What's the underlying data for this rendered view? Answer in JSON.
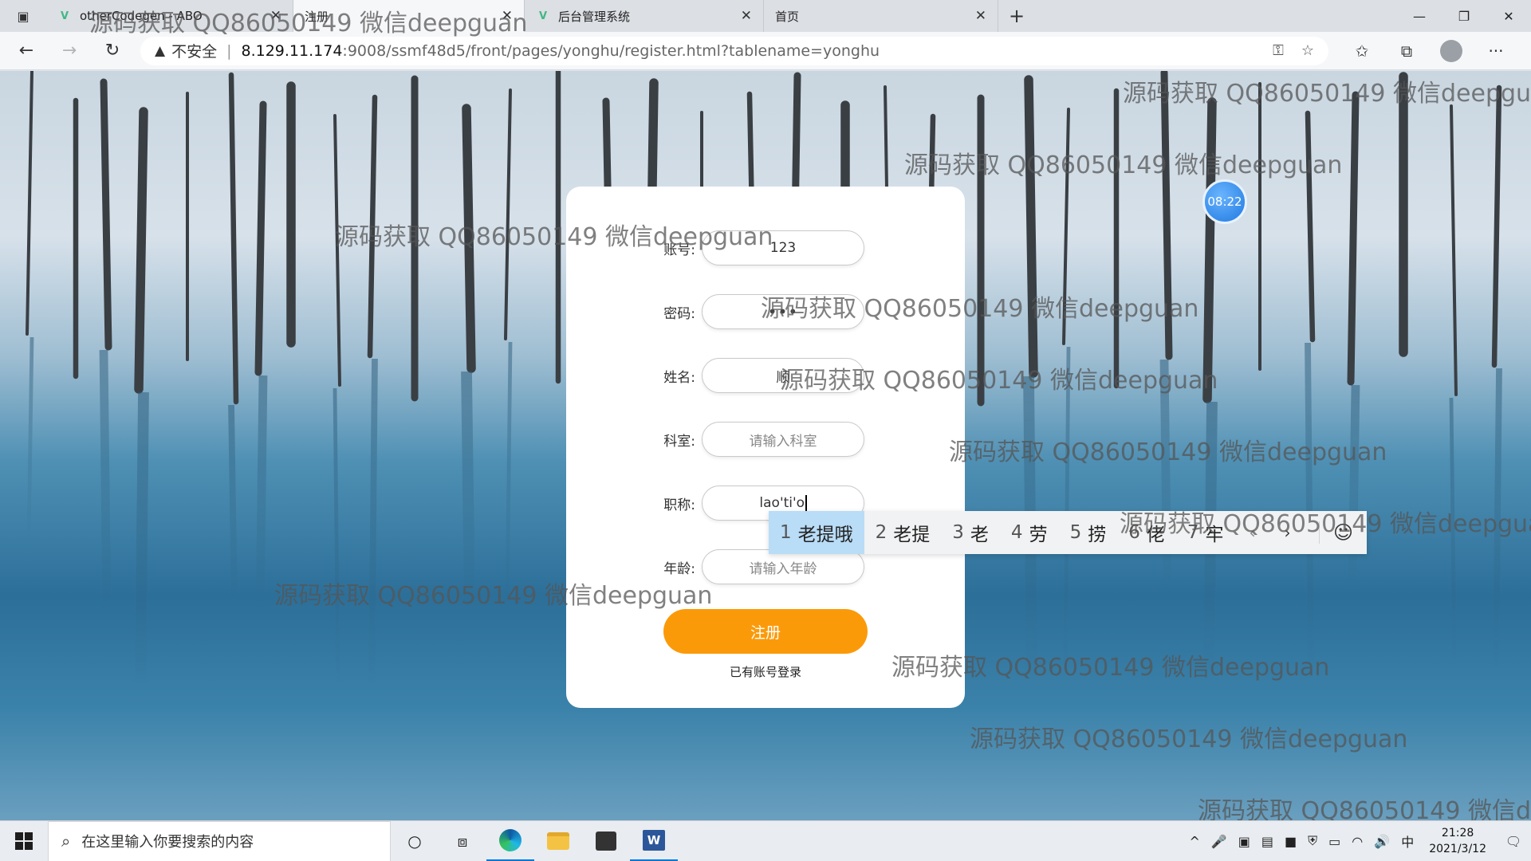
{
  "browser": {
    "tabs": [
      {
        "title": "otherCodegen - ABO",
        "icon": "vue-icon",
        "active": false
      },
      {
        "title": "注册",
        "icon": "page-icon",
        "active": true
      },
      {
        "title": "后台管理系统",
        "icon": "vue-icon",
        "active": false
      },
      {
        "title": "首页",
        "icon": "page-icon",
        "active": false
      }
    ],
    "address": {
      "security_label": "不安全",
      "host": "8.129.11.174",
      "rest": ":9008/ssmf48d5/front/pages/yonghu/register.html?tablename=yonghu"
    }
  },
  "overlay": {
    "bubble_time": "08:22"
  },
  "form": {
    "fields": [
      {
        "label": "账号:",
        "value": "123",
        "placeholder": "",
        "type": "text"
      },
      {
        "label": "密码:",
        "value": "•••",
        "placeholder": "",
        "type": "password"
      },
      {
        "label": "姓名:",
        "value": "顺",
        "placeholder": "",
        "type": "text"
      },
      {
        "label": "科室:",
        "value": "",
        "placeholder": "请输入科室",
        "type": "text"
      },
      {
        "label": "职称:",
        "value": "lao'ti'o",
        "placeholder": "",
        "type": "text"
      },
      {
        "label": "年龄:",
        "value": "",
        "placeholder": "请输入年龄",
        "type": "text"
      }
    ],
    "submit_label": "注册",
    "login_link": "已有账号登录"
  },
  "ime": {
    "candidates": [
      {
        "n": "1",
        "text": "老提哦"
      },
      {
        "n": "2",
        "text": "老提"
      },
      {
        "n": "3",
        "text": "老"
      },
      {
        "n": "4",
        "text": "劳"
      },
      {
        "n": "5",
        "text": "捞"
      },
      {
        "n": "6",
        "text": "佬"
      },
      {
        "n": "7",
        "text": "牢"
      }
    ]
  },
  "watermark": {
    "text": "源码获取 QQ86050149 微信deepguan"
  },
  "taskbar": {
    "search_placeholder": "在这里输入你要搜索的内容",
    "ime_indicator": "中",
    "time": "21:28",
    "date": "2021/3/12"
  },
  "colors": {
    "accent": "#fb9a09",
    "ime_selected": "#b9dcf7"
  }
}
